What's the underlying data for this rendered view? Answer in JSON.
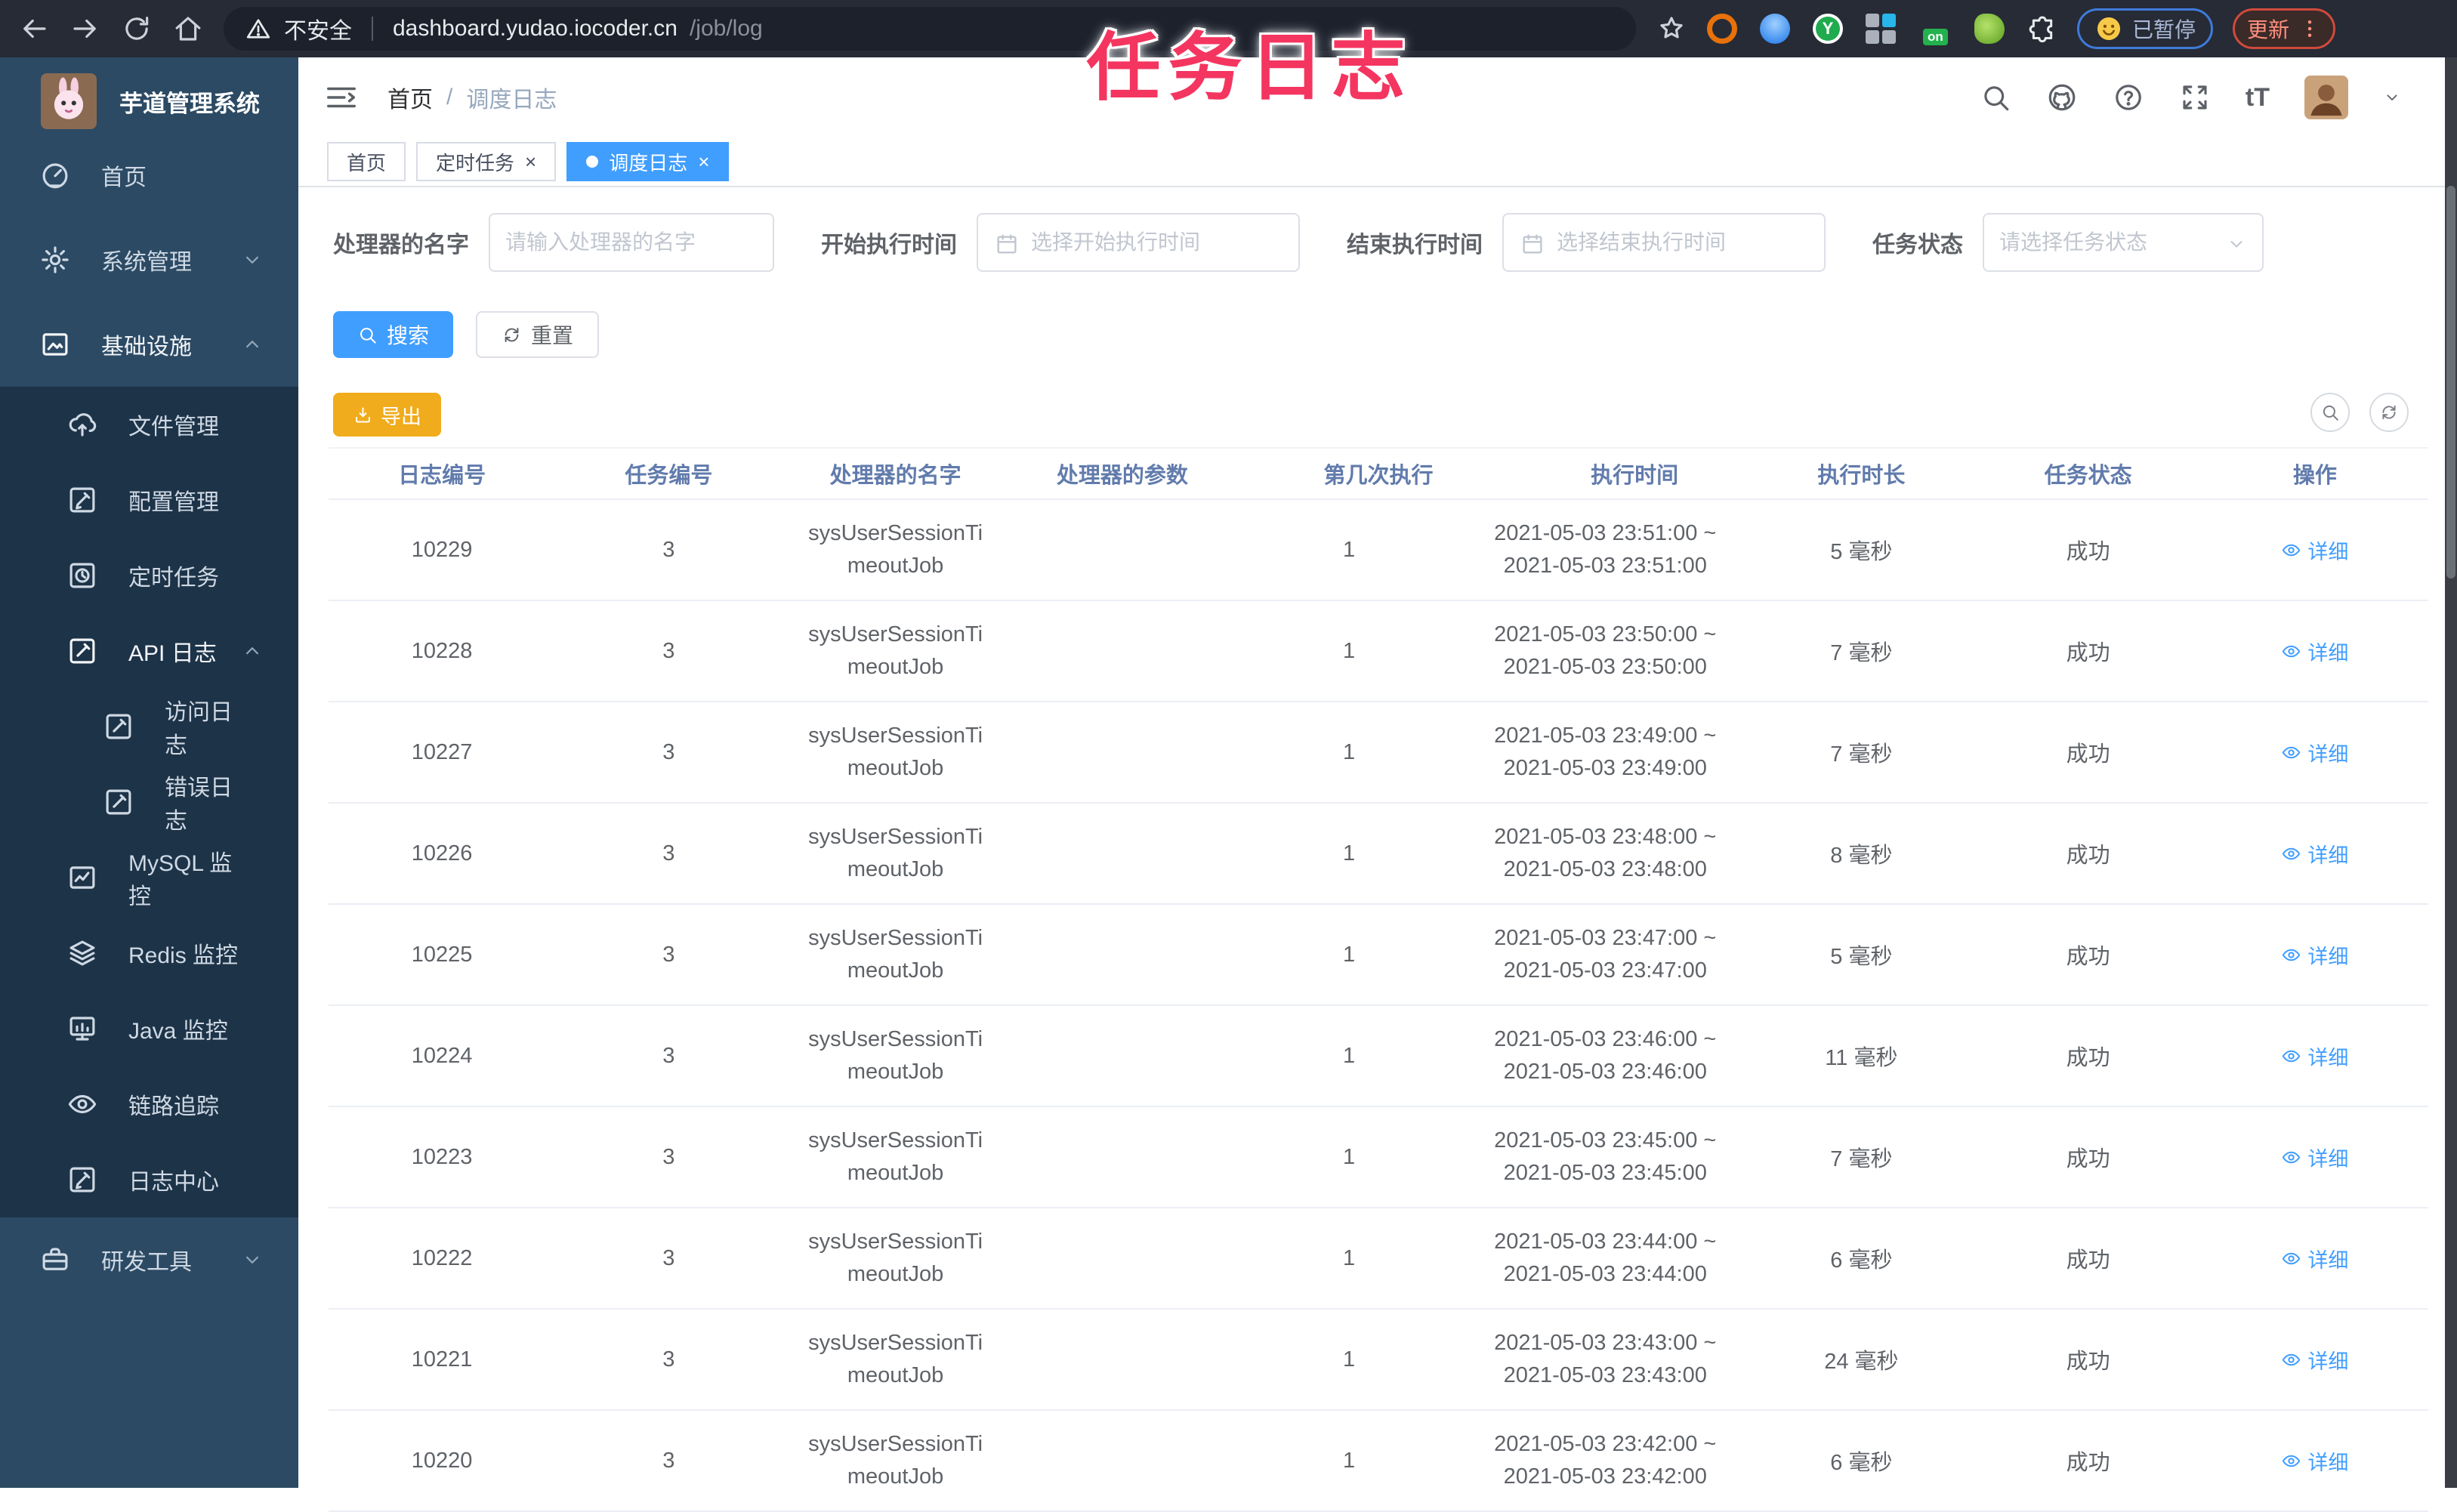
{
  "overlay_title": "任务日志",
  "browser": {
    "not_secure": "不安全",
    "url_host": "dashboard.yudao.iocoder.cn",
    "url_path": "/job/log",
    "ext_y": "Y",
    "ext_on": "on",
    "paused_label": "已暂停",
    "update_label": "更新"
  },
  "sidebar": {
    "app_title": "芋道管理系统",
    "items": [
      {
        "label": "首页",
        "icon": "dashboard-icon",
        "level": 1
      },
      {
        "label": "系统管理",
        "icon": "gear-icon",
        "level": 1,
        "chevron": "chevron-down-icon"
      },
      {
        "label": "基础设施",
        "icon": "infrastructure-icon",
        "level": 1,
        "chevron": "chevron-up-icon",
        "variant": "expanded"
      },
      {
        "label": "文件管理",
        "icon": "upload-cloud-icon",
        "level": 2
      },
      {
        "label": "配置管理",
        "icon": "edit-icon",
        "level": 2
      },
      {
        "label": "定时任务",
        "icon": "timer-icon",
        "level": 2
      },
      {
        "label": "API 日志",
        "icon": "api-log-icon",
        "level": 2,
        "chevron": "chevron-up-icon",
        "variant": "expanded"
      },
      {
        "label": "访问日志",
        "icon": "access-log-icon",
        "level": 3
      },
      {
        "label": "错误日志",
        "icon": "error-log-icon",
        "level": 3
      },
      {
        "label": "MySQL 监控",
        "icon": "chart-icon",
        "level": 2
      },
      {
        "label": "Redis 监控",
        "icon": "layers-icon",
        "level": 2
      },
      {
        "label": "Java 监控",
        "icon": "java-monitor-icon",
        "level": 2
      },
      {
        "label": "链路追踪",
        "icon": "eye-icon",
        "level": 2
      },
      {
        "label": "日志中心",
        "icon": "log-center-icon",
        "level": 2
      },
      {
        "label": "研发工具",
        "icon": "briefcase-icon",
        "level": 1,
        "chevron": "chevron-down-icon"
      }
    ]
  },
  "breadcrumb": {
    "home": "首页",
    "sep": "/",
    "current": "调度日志"
  },
  "tabs": {
    "home": {
      "label": "首页"
    },
    "job": {
      "label": "定时任务",
      "close": "×"
    },
    "job_log": {
      "label": "调度日志",
      "close": "×"
    }
  },
  "filters": {
    "handler_name": {
      "label": "处理器的名字",
      "placeholder": "请输入处理器的名字"
    },
    "begin_time": {
      "label": "开始执行时间",
      "placeholder": "选择开始执行时间"
    },
    "end_time": {
      "label": "结束执行时间",
      "placeholder": "选择结束执行时间"
    },
    "status": {
      "label": "任务状态",
      "placeholder": "请选择任务状态"
    }
  },
  "actions": {
    "search": "搜索",
    "reset": "重置",
    "export": "导出"
  },
  "colors": {
    "accent": "#409eff",
    "warning": "#f0ac1c",
    "overlay": "#f43560",
    "success_text": "#5f6368"
  },
  "table": {
    "columns": [
      "日志编号",
      "任务编号",
      "处理器的名字",
      "处理器的参数",
      "第几次执行",
      "执行时间",
      "执行时长",
      "任务状态",
      "操作"
    ],
    "rows": [
      {
        "id": "10229",
        "task_id": "3",
        "handler": "sysUserSessionTimeoutJob",
        "param": "",
        "times": "1",
        "time_start": "2021-05-03 23:51:00 ~",
        "time_end": "2021-05-03 23:51:00",
        "duration": "5 毫秒",
        "status": "成功",
        "action": "详细"
      },
      {
        "id": "10228",
        "task_id": "3",
        "handler": "sysUserSessionTimeoutJob",
        "param": "",
        "times": "1",
        "time_start": "2021-05-03 23:50:00 ~",
        "time_end": "2021-05-03 23:50:00",
        "duration": "7 毫秒",
        "status": "成功",
        "action": "详细"
      },
      {
        "id": "10227",
        "task_id": "3",
        "handler": "sysUserSessionTimeoutJob",
        "param": "",
        "times": "1",
        "time_start": "2021-05-03 23:49:00 ~",
        "time_end": "2021-05-03 23:49:00",
        "duration": "7 毫秒",
        "status": "成功",
        "action": "详细"
      },
      {
        "id": "10226",
        "task_id": "3",
        "handler": "sysUserSessionTimeoutJob",
        "param": "",
        "times": "1",
        "time_start": "2021-05-03 23:48:00 ~",
        "time_end": "2021-05-03 23:48:00",
        "duration": "8 毫秒",
        "status": "成功",
        "action": "详细"
      },
      {
        "id": "10225",
        "task_id": "3",
        "handler": "sysUserSessionTimeoutJob",
        "param": "",
        "times": "1",
        "time_start": "2021-05-03 23:47:00 ~",
        "time_end": "2021-05-03 23:47:00",
        "duration": "5 毫秒",
        "status": "成功",
        "action": "详细"
      },
      {
        "id": "10224",
        "task_id": "3",
        "handler": "sysUserSessionTimeoutJob",
        "param": "",
        "times": "1",
        "time_start": "2021-05-03 23:46:00 ~",
        "time_end": "2021-05-03 23:46:00",
        "duration": "11 毫秒",
        "status": "成功",
        "action": "详细"
      },
      {
        "id": "10223",
        "task_id": "3",
        "handler": "sysUserSessionTimeoutJob",
        "param": "",
        "times": "1",
        "time_start": "2021-05-03 23:45:00 ~",
        "time_end": "2021-05-03 23:45:00",
        "duration": "7 毫秒",
        "status": "成功",
        "action": "详细"
      },
      {
        "id": "10222",
        "task_id": "3",
        "handler": "sysUserSessionTimeoutJob",
        "param": "",
        "times": "1",
        "time_start": "2021-05-03 23:44:00 ~",
        "time_end": "2021-05-03 23:44:00",
        "duration": "6 毫秒",
        "status": "成功",
        "action": "详细"
      },
      {
        "id": "10221",
        "task_id": "3",
        "handler": "sysUserSessionTimeoutJob",
        "param": "",
        "times": "1",
        "time_start": "2021-05-03 23:43:00 ~",
        "time_end": "2021-05-03 23:43:00",
        "duration": "24 毫秒",
        "status": "成功",
        "action": "详细"
      },
      {
        "id": "10220",
        "task_id": "3",
        "handler": "sysUserSessionTimeoutJob",
        "param": "",
        "times": "1",
        "time_start": "2021-05-03 23:42:00 ~",
        "time_end": "2021-05-03 23:42:00",
        "duration": "6 毫秒",
        "status": "成功",
        "action": "详细"
      }
    ]
  }
}
